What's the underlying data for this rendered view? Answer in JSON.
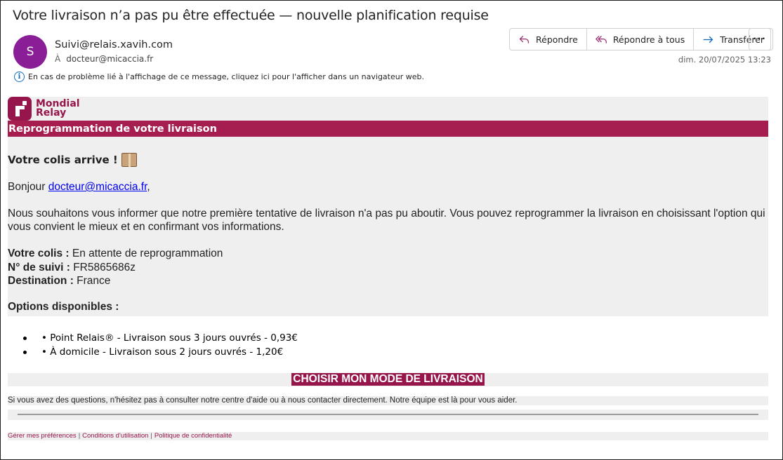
{
  "email": {
    "subject": "Votre livraison n’a pas pu être effectuée — nouvelle planification requise",
    "avatar_initial": "S",
    "sender": "Suivi@relais.xavih.com",
    "to_label": "À",
    "to": "docteur@micaccia.fr",
    "date": "dim. 20/07/2025 13:23",
    "info_text": "En cas de problème lié à l'affichage de ce message, cliquez ici pour l'afficher dans un navigateur web."
  },
  "actions": {
    "reply": "Répondre",
    "reply_all": "Répondre à tous",
    "forward": "Transférer",
    "more": "···"
  },
  "message": {
    "logo_line1": "Mondial",
    "logo_line2": "Relay",
    "banner": "Reprogrammation de votre livraison",
    "headline": "Votre colis arrive !",
    "greeting_prefix": "Bonjour ",
    "greeting_link": "docteur@micaccia.fr",
    "greeting_suffix": ",",
    "paragraph": "Nous souhaitons vous informer que notre première tentative de livraison n'a pas pu aboutir. Vous pouvez reprogrammer la livraison en choisissant l'option qui vous convient le mieux et en confirmant vos informations.",
    "status_label": "Votre colis :",
    "status_value": " En attente de reprogrammation",
    "tracking_label": "N° de suivi :",
    "tracking_value": " FR5865686z",
    "destination_label": "Destination :",
    "destination_value": " France",
    "options_title": "Options disponibles :",
    "options": [
      "• Point Relais® - Livraison sous 3 jours ouvrés - 0,93€",
      "• À domicile - Livraison sous 2 jours ouvrés - 1,20€"
    ],
    "cta": "CHOISIR MON MODE DE LIVRAISON",
    "help": "Si vous avez des questions, n'hésitez pas à consulter notre centre d'aide ou à nous contacter directement. Notre équipe est là pour vous aider.",
    "footer_links": [
      "Gérer mes préférences",
      "Conditions d'utilisation",
      "Politique de confidentialité"
    ],
    "footer_separator": "|"
  },
  "colors": {
    "brand": "#96154a",
    "banner": "#a51e4f",
    "avatar": "#8a1e97",
    "link": "#0000ee",
    "accent": "#0f6cbd"
  }
}
